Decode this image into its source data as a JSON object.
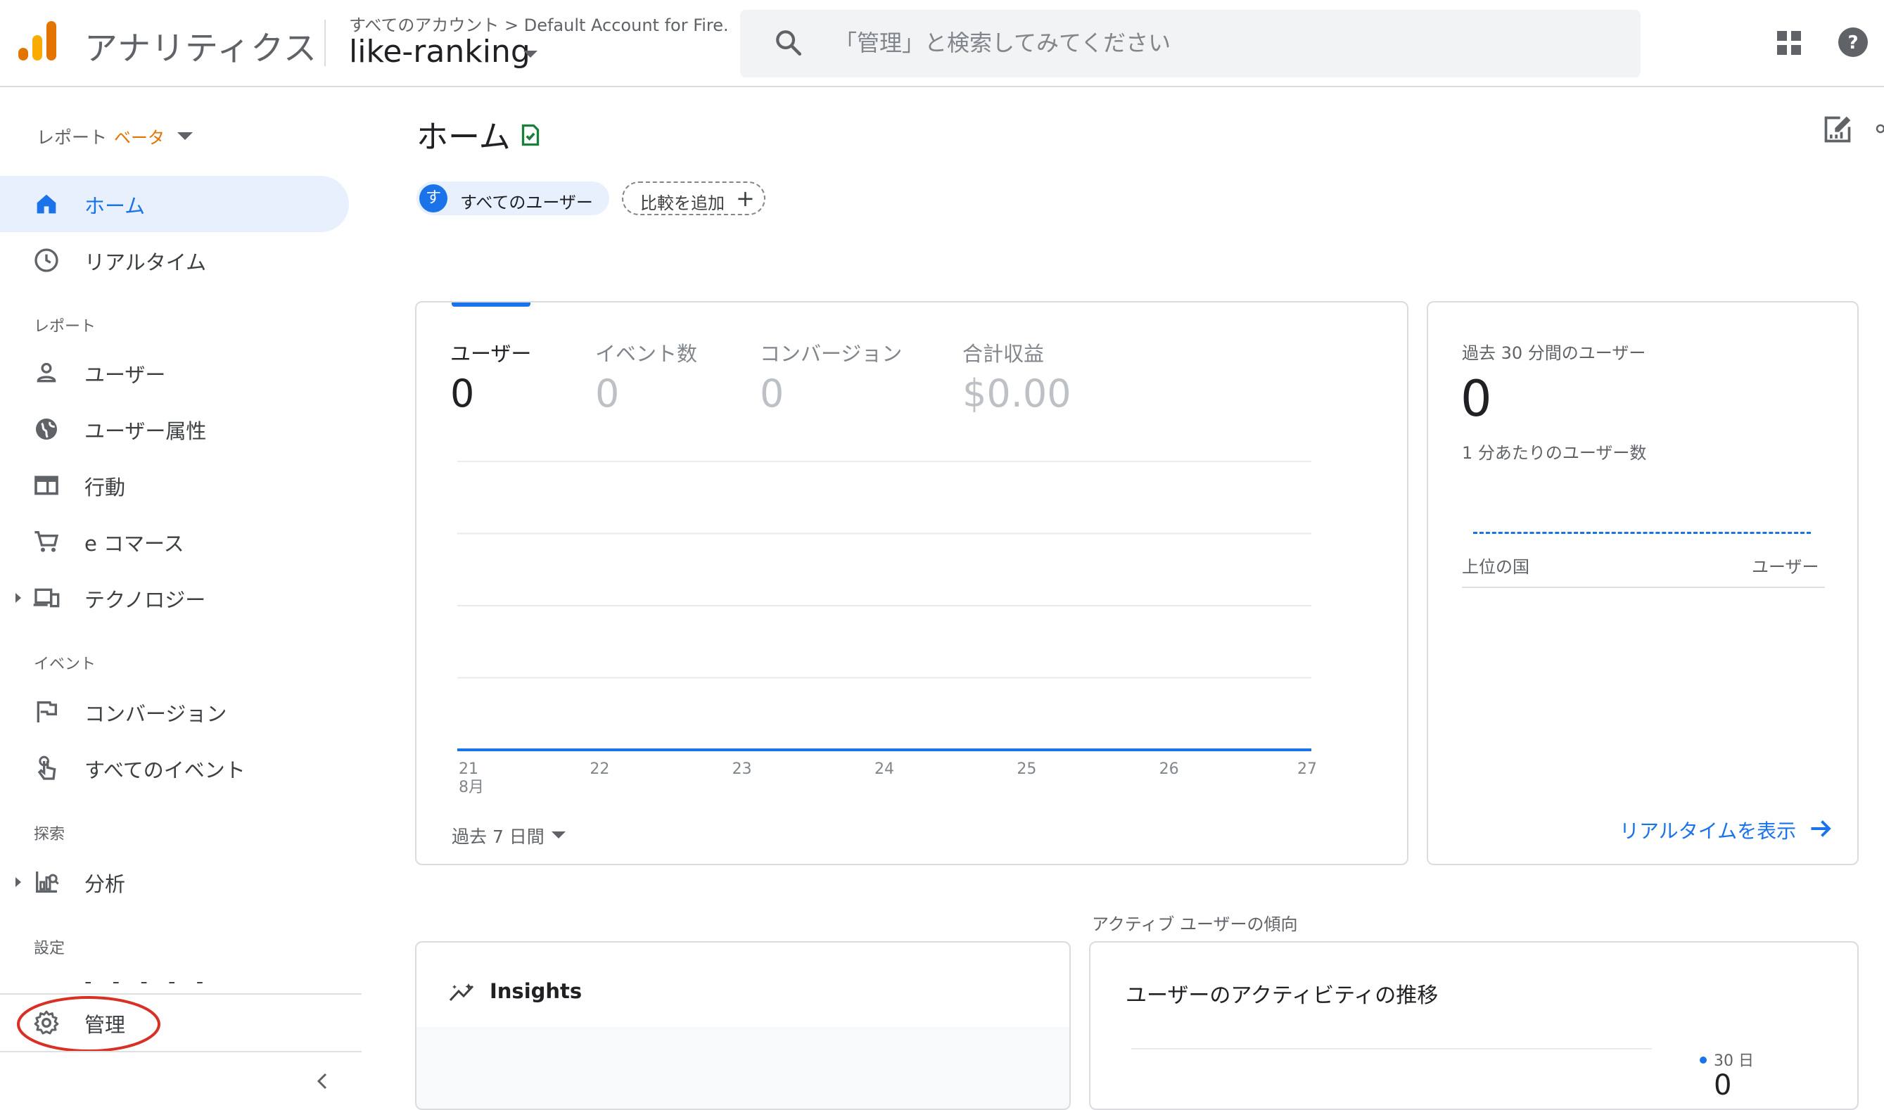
{
  "header": {
    "app_title": "アナリティクス",
    "breadcrumb": "すべてのアカウント > Default Account for Fire...",
    "property_name": "like-ranking",
    "search_placeholder": "「管理」と検索してみてください",
    "icons": {
      "logo": "analytics-logo",
      "search": "search-icon",
      "apps": "apps-grid-icon",
      "help": "help-icon"
    }
  },
  "sidebar": {
    "reports_title": "レポート",
    "beta_label": "ベータ",
    "items_top": [
      {
        "label": "ホーム",
        "icon": "home-icon",
        "active": true
      },
      {
        "label": "リアルタイム",
        "icon": "clock-icon",
        "active": false
      }
    ],
    "section_reports": "レポート",
    "items_reports": [
      {
        "label": "ユーザー",
        "icon": "person-icon"
      },
      {
        "label": "ユーザー属性",
        "icon": "globe-icon"
      },
      {
        "label": "行動",
        "icon": "layout-icon"
      },
      {
        "label": "e コマース",
        "icon": "cart-icon"
      },
      {
        "label": "テクノロジー",
        "icon": "devices-icon"
      }
    ],
    "section_events": "イベント",
    "items_events": [
      {
        "label": "コンバージョン",
        "icon": "flag-icon"
      },
      {
        "label": "すべてのイベント",
        "icon": "touch-icon"
      }
    ],
    "section_explore": "探索",
    "items_explore": [
      {
        "label": "分析",
        "icon": "analysis-icon"
      }
    ],
    "section_settings": "設定",
    "admin": {
      "label": "管理",
      "icon": "gear-icon"
    },
    "collapse_icon": "chevron-left-icon",
    "highlight_color": "#d93025"
  },
  "main": {
    "title": "ホーム",
    "chips": {
      "all_users_initial": "す",
      "all_users": "すべてのユーザー",
      "add_compare": "比較を追加",
      "plus": "+"
    },
    "metrics": [
      {
        "label": "ユーザー",
        "value": "0",
        "active": true
      },
      {
        "label": "イベント数",
        "value": "0",
        "active": false
      },
      {
        "label": "コンバージョン",
        "value": "0",
        "active": false
      },
      {
        "label": "合計収益",
        "value": "$0.00",
        "active": false
      }
    ],
    "date_range": "過去 7 日間",
    "realtime": {
      "title": "過去 30 分間のユーザー",
      "value": "0",
      "subtitle": "1 分あたりのユーザー数",
      "col_country": "上位の国",
      "col_users": "ユーザー",
      "link": "リアルタイムを表示"
    },
    "trend_heading": "アクティブ ユーザーの傾向",
    "insights_title": "Insights",
    "activity_title": "ユーザーのアクティビティの推移",
    "activity_legend": "30 日",
    "activity_value": "0",
    "accent_color": "#1a73e8"
  },
  "chart_data": {
    "type": "line",
    "x": [
      "21",
      "22",
      "23",
      "24",
      "25",
      "26",
      "27"
    ],
    "x_month_label": "8月",
    "series": [
      {
        "values": [
          0,
          0,
          0,
          0,
          0,
          0,
          0
        ]
      }
    ],
    "grid": true,
    "color": "#1a73e8"
  }
}
